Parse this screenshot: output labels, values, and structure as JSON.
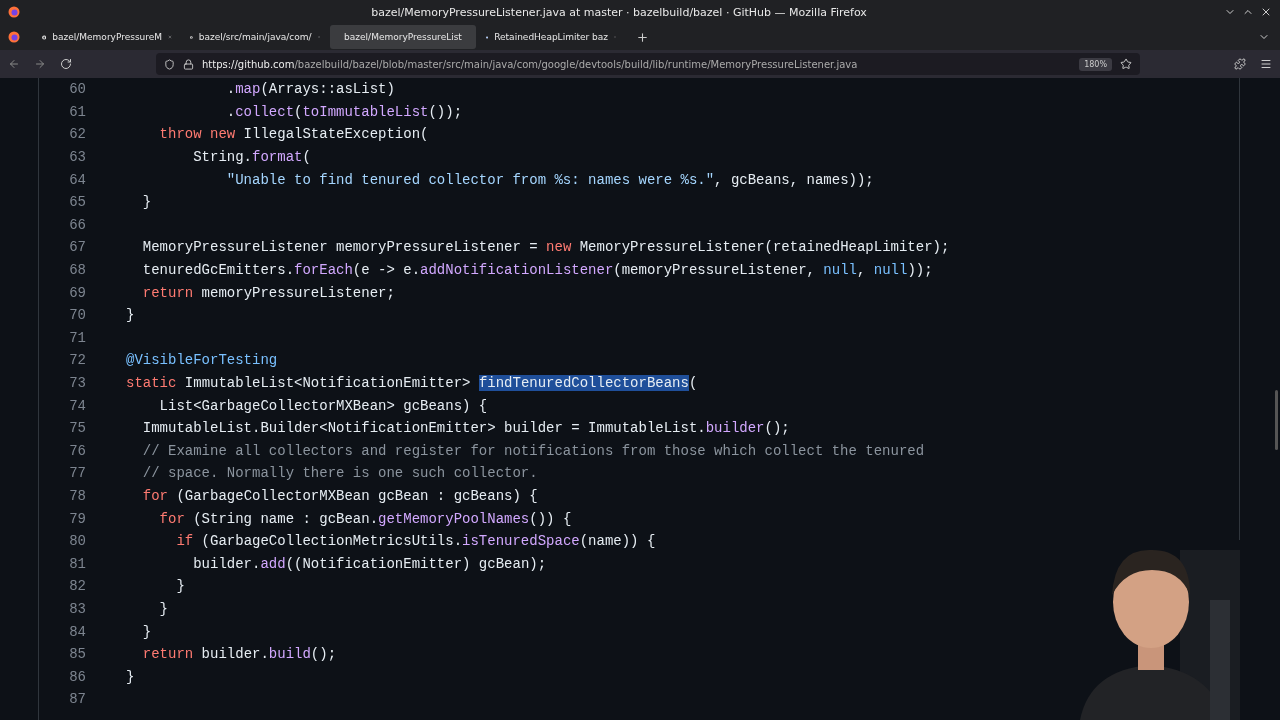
{
  "window": {
    "title": "bazel/MemoryPressureListener.java at master · bazelbuild/bazel · GitHub — Mozilla Firefox"
  },
  "tabs": [
    {
      "label": "bazel/MemoryPressureM",
      "selected": false
    },
    {
      "label": "bazel/src/main/java/com/",
      "selected": false
    },
    {
      "label": "bazel/MemoryPressureList",
      "selected": true
    },
    {
      "label": "RetainedHeapLimiter baz",
      "selected": false
    }
  ],
  "address_bar": {
    "url_host": "https://github.com",
    "url_path": "/bazelbuild/bazel/blob/master/src/main/java/com/google/devtools/build/lib/runtime/MemoryPressureListener.java",
    "zoom": "180%"
  },
  "code_lines": [
    {
      "number": "60",
      "tokens": [
        {
          "kind": "plain",
          "text": "            ."
        },
        {
          "kind": "function",
          "text": "map"
        },
        {
          "kind": "plain",
          "text": "(Arrays::asList)"
        }
      ]
    },
    {
      "number": "61",
      "tokens": [
        {
          "kind": "plain",
          "text": "            ."
        },
        {
          "kind": "function",
          "text": "collect"
        },
        {
          "kind": "plain",
          "text": "("
        },
        {
          "kind": "function",
          "text": "toImmutableList"
        },
        {
          "kind": "plain",
          "text": "());"
        }
      ]
    },
    {
      "number": "62",
      "tokens": [
        {
          "kind": "keyword",
          "text": "    throw new"
        },
        {
          "kind": "plain",
          "text": " IllegalStateException("
        }
      ]
    },
    {
      "number": "63",
      "tokens": [
        {
          "kind": "plain",
          "text": "        String."
        },
        {
          "kind": "function",
          "text": "format"
        },
        {
          "kind": "plain",
          "text": "("
        }
      ]
    },
    {
      "number": "64",
      "tokens": [
        {
          "kind": "string",
          "text": "            \"Unable to find tenured collector from %s: names were %s.\""
        },
        {
          "kind": "plain",
          "text": ", gcBeans, names));"
        }
      ]
    },
    {
      "number": "65",
      "tokens": [
        {
          "kind": "plain",
          "text": "  }"
        }
      ]
    },
    {
      "number": "66"
    },
    {
      "number": "67",
      "tokens": [
        {
          "kind": "plain",
          "text": "  MemoryPressureListener memoryPressureListener = "
        },
        {
          "kind": "keyword",
          "text": "new"
        },
        {
          "kind": "plain",
          "text": " MemoryPressureListener(retainedHeapLimiter);"
        }
      ]
    },
    {
      "number": "68",
      "tokens": [
        {
          "kind": "plain",
          "text": "  tenuredGcEmitters."
        },
        {
          "kind": "function",
          "text": "forEach"
        },
        {
          "kind": "plain",
          "text": "(e -> e."
        },
        {
          "kind": "function",
          "text": "addNotificationListener"
        },
        {
          "kind": "plain",
          "text": "(memoryPressureListener, "
        },
        {
          "kind": "constant",
          "text": "null"
        },
        {
          "kind": "plain",
          "text": ", "
        },
        {
          "kind": "constant",
          "text": "null"
        },
        {
          "kind": "plain",
          "text": "));"
        }
      ]
    },
    {
      "number": "69",
      "tokens": [
        {
          "kind": "keyword",
          "text": "  return"
        },
        {
          "kind": "plain",
          "text": " memoryPressureListener;"
        }
      ]
    },
    {
      "number": "70",
      "tokens": [
        {
          "kind": "plain",
          "text": "}"
        }
      ]
    },
    {
      "number": "71"
    },
    {
      "number": "72",
      "tokens": [
        {
          "kind": "constant",
          "text": "@VisibleForTesting"
        }
      ]
    },
    {
      "number": "73",
      "tokens": [
        {
          "kind": "keyword",
          "text": "static"
        },
        {
          "kind": "plain",
          "text": " ImmutableList<NotificationEmitter> "
        },
        {
          "kind": "selection",
          "text": "findTenuredCollectorBeans"
        },
        {
          "kind": "plain",
          "text": "("
        }
      ]
    },
    {
      "number": "74",
      "tokens": [
        {
          "kind": "plain",
          "text": "    List<GarbageCollectorMXBean> gcBeans) {"
        }
      ]
    },
    {
      "number": "75",
      "tokens": [
        {
          "kind": "plain",
          "text": "  ImmutableList.Builder<NotificationEmitter> builder = ImmutableList."
        },
        {
          "kind": "function",
          "text": "builder"
        },
        {
          "kind": "plain",
          "text": "();"
        }
      ]
    },
    {
      "number": "76",
      "tokens": [
        {
          "kind": "comment",
          "text": "  // Examine all collectors and register for notifications from those which collect the tenured"
        }
      ]
    },
    {
      "number": "77",
      "tokens": [
        {
          "kind": "comment",
          "text": "  // space. Normally there is one such collector."
        }
      ]
    },
    {
      "number": "78",
      "tokens": [
        {
          "kind": "keyword",
          "text": "  for"
        },
        {
          "kind": "plain",
          "text": " (GarbageCollectorMXBean gcBean : gcBeans) {"
        }
      ]
    },
    {
      "number": "79",
      "tokens": [
        {
          "kind": "keyword",
          "text": "    for"
        },
        {
          "kind": "plain",
          "text": " (String name : gcBean."
        },
        {
          "kind": "function",
          "text": "getMemoryPoolNames"
        },
        {
          "kind": "plain",
          "text": "()) {"
        }
      ]
    },
    {
      "number": "80",
      "tokens": [
        {
          "kind": "keyword",
          "text": "      if"
        },
        {
          "kind": "plain",
          "text": " (GarbageCollectionMetricsUtils."
        },
        {
          "kind": "function",
          "text": "isTenuredSpace"
        },
        {
          "kind": "plain",
          "text": "(name)) {"
        }
      ]
    },
    {
      "number": "81",
      "tokens": [
        {
          "kind": "plain",
          "text": "        builder."
        },
        {
          "kind": "function",
          "text": "add"
        },
        {
          "kind": "plain",
          "text": "((NotificationEmitter) gcBean);"
        }
      ]
    },
    {
      "number": "82",
      "tokens": [
        {
          "kind": "plain",
          "text": "      }"
        }
      ]
    },
    {
      "number": "83",
      "tokens": [
        {
          "kind": "plain",
          "text": "    }"
        }
      ]
    },
    {
      "number": "84",
      "tokens": [
        {
          "kind": "plain",
          "text": "  }"
        }
      ]
    },
    {
      "number": "85",
      "tokens": [
        {
          "kind": "keyword",
          "text": "  return"
        },
        {
          "kind": "plain",
          "text": " builder."
        },
        {
          "kind": "function",
          "text": "build"
        },
        {
          "kind": "plain",
          "text": "();"
        }
      ]
    },
    {
      "number": "86",
      "tokens": [
        {
          "kind": "plain",
          "text": "}"
        }
      ]
    },
    {
      "number": "87"
    }
  ]
}
